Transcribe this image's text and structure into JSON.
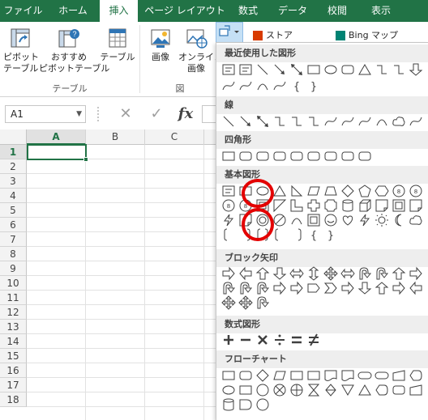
{
  "tabs": [
    {
      "label": "ファイル",
      "active": false
    },
    {
      "label": "ホーム",
      "active": false
    },
    {
      "label": "挿入",
      "active": true
    },
    {
      "label": "ページ レイアウト",
      "active": false
    },
    {
      "label": "数式",
      "active": false
    },
    {
      "label": "データ",
      "active": false
    },
    {
      "label": "校閲",
      "active": false
    },
    {
      "label": "表示",
      "active": false
    }
  ],
  "ribbon": {
    "pivot_line1": "ピボット",
    "pivot_line2": "テーブル",
    "recpivot_line1": "おすすめ",
    "recpivot_line2": "ピボットテーブル",
    "table": "テーブル",
    "group_table": "テーブル",
    "picture": "画像",
    "online_line1": "オンライン",
    "online_line2": "画像",
    "group_illust": "図",
    "store": "ストア",
    "bing": "Bing マップ"
  },
  "formula_bar": {
    "name_box": "A1",
    "fx": "fx",
    "cancel_icon": "✕",
    "enter_icon": "✓"
  },
  "grid": {
    "columns": [
      "A",
      "B",
      "C"
    ],
    "rows": [
      "1",
      "2",
      "3",
      "4",
      "5",
      "6",
      "7",
      "8",
      "9",
      "10",
      "11",
      "12",
      "13",
      "14",
      "15",
      "16",
      "17",
      "18"
    ],
    "selected_cell": "A1"
  },
  "shapes_menu": {
    "recent": "最近使用した図形",
    "lines": "線",
    "rectangles": "四角形",
    "basic": "基本図形",
    "block_arrows": "ブロック矢印",
    "equation": "数式図形",
    "flowchart": "フローチャート"
  },
  "colors": {
    "excel_green": "#217346",
    "annotation_red": "#e30000"
  }
}
